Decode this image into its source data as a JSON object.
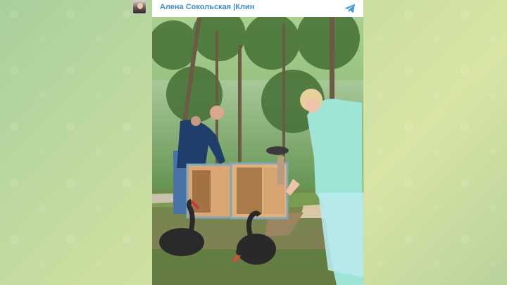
{
  "post": {
    "channel_name": "Алена Сокольская |Клин",
    "avatar_icon": "author-avatar",
    "share_icon": "telegram-icon"
  },
  "colors": {
    "accent": "#3d8ed0",
    "background_green": "#b9d39a"
  }
}
